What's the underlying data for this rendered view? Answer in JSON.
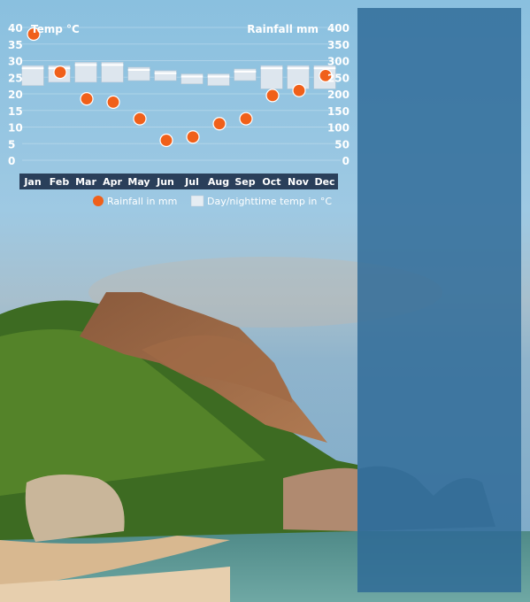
{
  "chart_data": {
    "type": "bar+scatter",
    "title_left": "Temp °C",
    "title_right": "Rainfall mm",
    "categories": [
      "Jan",
      "Feb",
      "Mar",
      "Apr",
      "May",
      "Jun",
      "Jul",
      "Aug",
      "Sep",
      "Oct",
      "Nov",
      "Dec"
    ],
    "y_left": {
      "label": "Temp °C",
      "ticks": [
        40,
        35,
        30,
        25,
        20,
        15,
        10,
        5,
        0
      ],
      "range": [
        0,
        40
      ]
    },
    "y_right": {
      "label": "Rainfall mm",
      "ticks": [
        400,
        350,
        300,
        250,
        200,
        150,
        100,
        50,
        0
      ],
      "range": [
        0,
        400
      ]
    },
    "series": [
      {
        "name": "Day/nighttime temp in °C",
        "kind": "range-bar",
        "low": [
          22.5,
          23.5,
          23.5,
          23.5,
          24,
          24,
          23,
          22.5,
          24,
          21.5,
          21.5,
          21.5
        ],
        "high": [
          28.5,
          28.5,
          29.5,
          29.5,
          28,
          27,
          26,
          26,
          27.5,
          28.5,
          28.5,
          28.5
        ]
      },
      {
        "name": "Rainfall in mm",
        "kind": "point",
        "values": [
          380,
          265,
          185,
          175,
          125,
          60,
          70,
          110,
          125,
          195,
          210,
          255
        ]
      }
    ],
    "legend": [
      "Rainfall in mm",
      "Day/nighttime temp in °C"
    ],
    "legend_position": "bottom",
    "colors": {
      "rain": "#f0601a",
      "bar": "#dde6ee",
      "axis_band": "#2a3f5a"
    }
  }
}
